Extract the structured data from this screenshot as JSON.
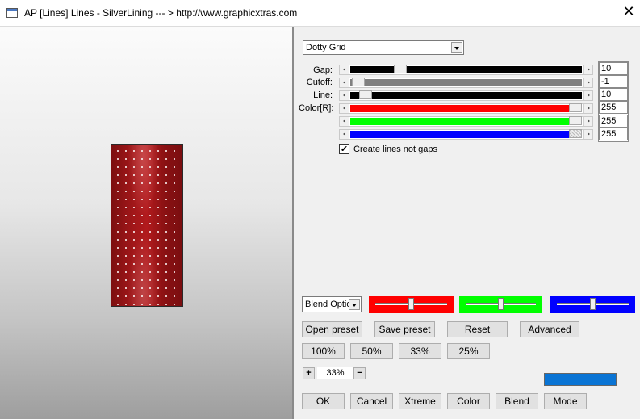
{
  "window": {
    "title": "AP [Lines]  Lines - SilverLining    --- > http://www.graphicxtras.com",
    "close_glyph": "✕"
  },
  "preset_dropdown": {
    "selected": "Dotty Grid"
  },
  "sliders": [
    {
      "label": "Gap:",
      "value": "10",
      "position": 0.2,
      "fill": "#000000"
    },
    {
      "label": "Cutoff:",
      "value": "-1",
      "position": 0.0,
      "fill": "#808080"
    },
    {
      "label": "Line:",
      "value": "10",
      "position": 0.04,
      "fill": "#000000"
    },
    {
      "label": "Color[R]:",
      "value": "255",
      "position": 1.0,
      "fill": "#ff0000"
    },
    {
      "label": "",
      "value": "255",
      "position": 1.0,
      "fill": "#00ff00"
    },
    {
      "label": "",
      "value": "255",
      "position": 1.0,
      "fill": "#0000ff"
    }
  ],
  "checkbox": {
    "label": "Create lines not gaps",
    "checked": true,
    "mark": "✔"
  },
  "blend_dropdown": {
    "selected": "Blend Optio"
  },
  "color_bars": [
    {
      "color": "#ff0000",
      "position": 0.5
    },
    {
      "color": "#00ff00",
      "position": 0.5
    },
    {
      "color": "#0000ff",
      "position": 0.5
    }
  ],
  "buttons": {
    "open_preset": "Open preset",
    "save_preset": "Save preset",
    "reset": "Reset",
    "advanced": "Advanced",
    "zoom_100": "100%",
    "zoom_50": "50%",
    "zoom_33": "33%",
    "zoom_25": "25%",
    "plus": "+",
    "minus": "−",
    "ok": "OK",
    "cancel": "Cancel",
    "xtreme": "Xtreme",
    "color": "Color",
    "blend": "Blend",
    "mode": "Mode"
  },
  "zoom": {
    "value": "33%"
  },
  "colors": {
    "swatch": "#0a74d4",
    "preview_red": "#8e1212"
  }
}
